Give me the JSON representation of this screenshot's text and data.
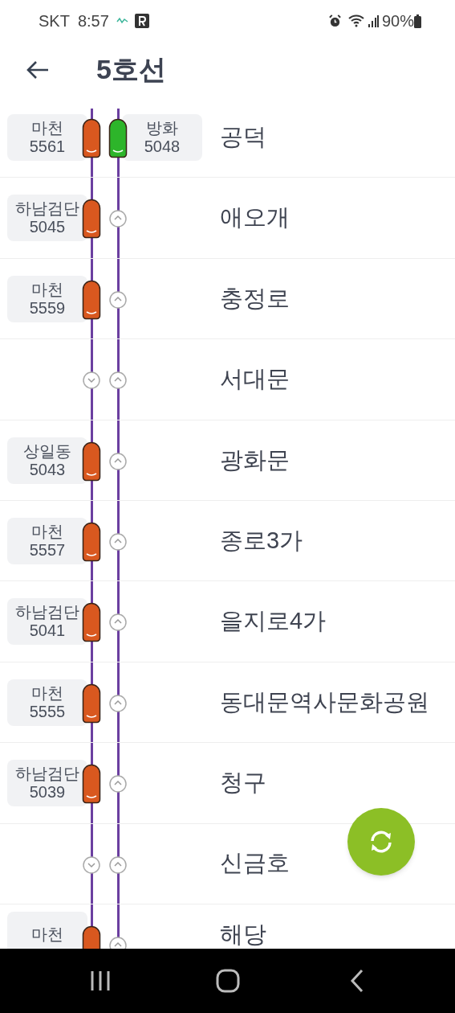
{
  "status_bar": {
    "carrier": "SKT",
    "time": "8:57",
    "battery": "90%"
  },
  "header": {
    "title": "5호선"
  },
  "stations": [
    {
      "name": "공덕",
      "down_train": {
        "destination": "마천",
        "number": "5561",
        "color": "#d9581f"
      },
      "up_train": {
        "destination": "방화",
        "number": "5048",
        "color": "#2db52a"
      }
    },
    {
      "name": "애오개",
      "down_train": {
        "destination": "하남검단",
        "number": "5045",
        "color": "#d9581f"
      }
    },
    {
      "name": "충정로",
      "down_train": {
        "destination": "마천",
        "number": "5559",
        "color": "#d9581f"
      }
    },
    {
      "name": "서대문"
    },
    {
      "name": "광화문",
      "down_train": {
        "destination": "상일동",
        "number": "5043",
        "color": "#d9581f"
      }
    },
    {
      "name": "종로3가",
      "down_train": {
        "destination": "마천",
        "number": "5557",
        "color": "#d9581f"
      }
    },
    {
      "name": "을지로4가",
      "down_train": {
        "destination": "하남검단",
        "number": "5041",
        "color": "#d9581f"
      }
    },
    {
      "name": "동대문역사문화공원",
      "down_train": {
        "destination": "마천",
        "number": "5555",
        "color": "#d9581f"
      }
    },
    {
      "name": "청구",
      "down_train": {
        "destination": "하남검단",
        "number": "5039",
        "color": "#d9581f"
      }
    },
    {
      "name": "신금호"
    },
    {
      "name": "해당",
      "down_train": {
        "destination": "마천",
        "color": "#d9581f"
      }
    }
  ]
}
